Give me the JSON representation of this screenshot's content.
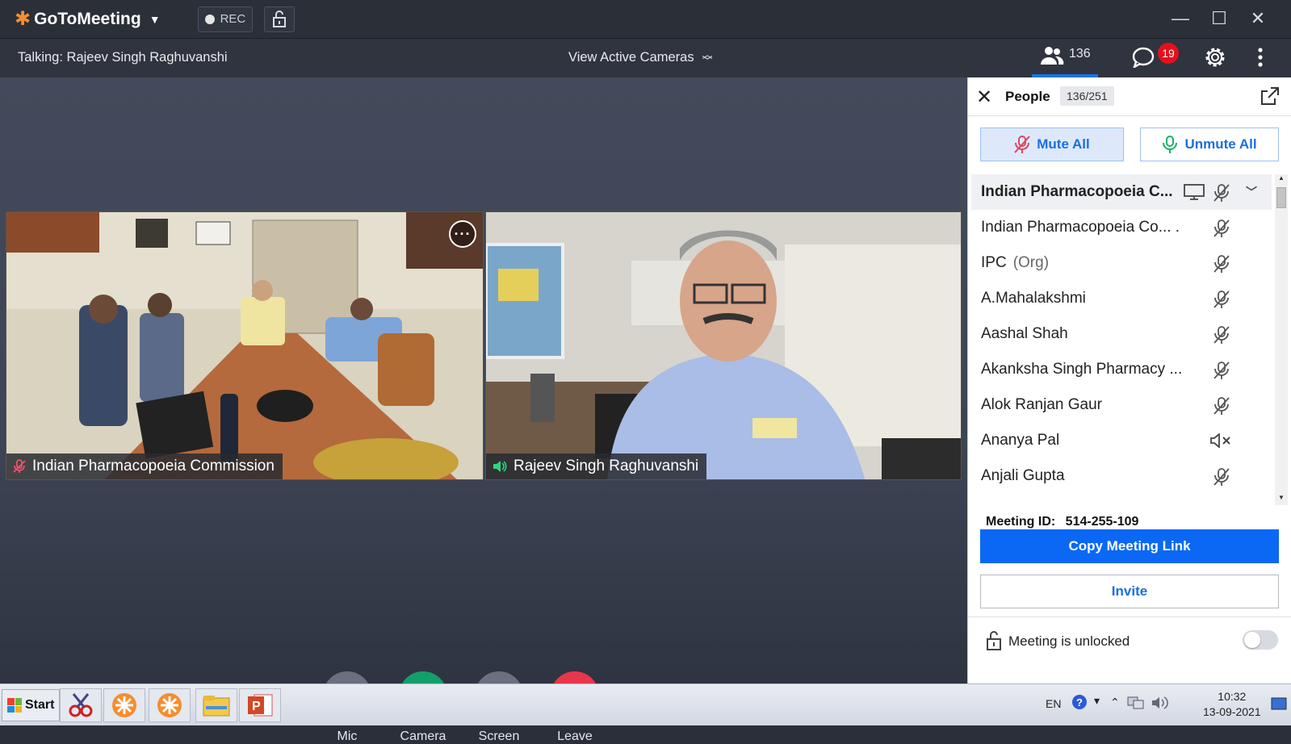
{
  "app": {
    "name": "GoToMeeting",
    "rec_label": "REC"
  },
  "infobar": {
    "talking": "Talking: Rajeev Singh Raghuvanshi",
    "view_cameras": "View Active Cameras",
    "people_count": "136",
    "chat_badge": "19"
  },
  "tiles": [
    {
      "name": "Indian Pharmacopoeia Commission",
      "audio": "muted"
    },
    {
      "name": "Rajeev Singh Raghuvanshi",
      "audio": "speaking"
    }
  ],
  "controls": {
    "mic": "Mic",
    "camera": "Camera",
    "screen": "Screen",
    "leave": "Leave"
  },
  "panel": {
    "title": "People",
    "count": "136/251",
    "mute_all": "Mute All",
    "unmute_all": "Unmute All",
    "group": "Indian Pharmacopoeia C...",
    "people": [
      {
        "name": "Indian Pharmacopoeia Co... .",
        "org": "",
        "icon": "mic-muted-icon"
      },
      {
        "name": "IPC",
        "org": "(Org)",
        "icon": "mic-muted-icon"
      },
      {
        "name": "A.Mahalakshmi",
        "org": "",
        "icon": "mic-muted-icon"
      },
      {
        "name": "Aashal Shah",
        "org": "",
        "icon": "mic-muted-icon"
      },
      {
        "name": "Akanksha Singh Pharmacy ...",
        "org": "",
        "icon": "mic-muted-icon"
      },
      {
        "name": "Alok Ranjan Gaur",
        "org": "",
        "icon": "mic-muted-icon"
      },
      {
        "name": "Ananya Pal",
        "org": "",
        "icon": "speaker-off-icon"
      },
      {
        "name": "Anjali Gupta",
        "org": "",
        "icon": "mic-muted-icon"
      }
    ],
    "meeting_id_label": "Meeting ID:",
    "meeting_id": "514-255-109",
    "copy_link": "Copy Meeting Link",
    "invite": "Invite",
    "lock_status": "Meeting is unlocked"
  },
  "taskbar": {
    "start": "Start",
    "lang": "EN",
    "time": "10:32",
    "date": "13-09-2021"
  },
  "colors": {
    "accent": "#0a68f5",
    "brand_orange": "#f68d2e",
    "camera_green": "#12a06a",
    "leave_red": "#e8374a",
    "badge_red": "#e4101c"
  }
}
